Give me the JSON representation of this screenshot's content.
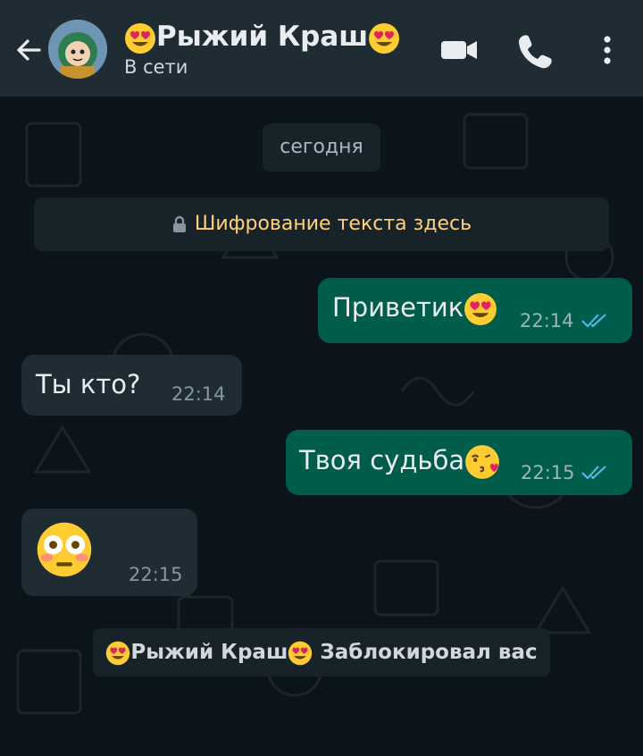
{
  "header": {
    "back_icon": "arrow-left-icon",
    "contact_name_text": "Рыжий Краш",
    "status": "В сети",
    "actions": [
      "video-call-icon",
      "phone-icon",
      "more-vert-icon"
    ]
  },
  "chat": {
    "date_label": "сегодня",
    "encryption_notice": "Шифрование текста здесь",
    "messages": [
      {
        "direction": "out",
        "text": "Приветик",
        "emoji": "heart-eyes-emoji",
        "time": "22:14",
        "status": "read"
      },
      {
        "direction": "in",
        "text": "Ты кто?",
        "time": "22:14"
      },
      {
        "direction": "out",
        "text": "Твоя судьба",
        "emoji": "kissing-heart-emoji",
        "time": "22:15",
        "status": "read"
      },
      {
        "direction": "in",
        "text": "",
        "emoji": "flushed-face-emoji",
        "time": "22:15"
      }
    ],
    "system_notice_name": "Рыжий Краш",
    "system_notice_text": "Заблокировал вас"
  },
  "colors": {
    "background": "#0b141a",
    "header": "#1f2c34",
    "outgoing_bubble": "#005c4b",
    "incoming_bubble": "#1f2c34",
    "encryption_text": "#ffd279",
    "read_tick": "#53bdeb"
  }
}
